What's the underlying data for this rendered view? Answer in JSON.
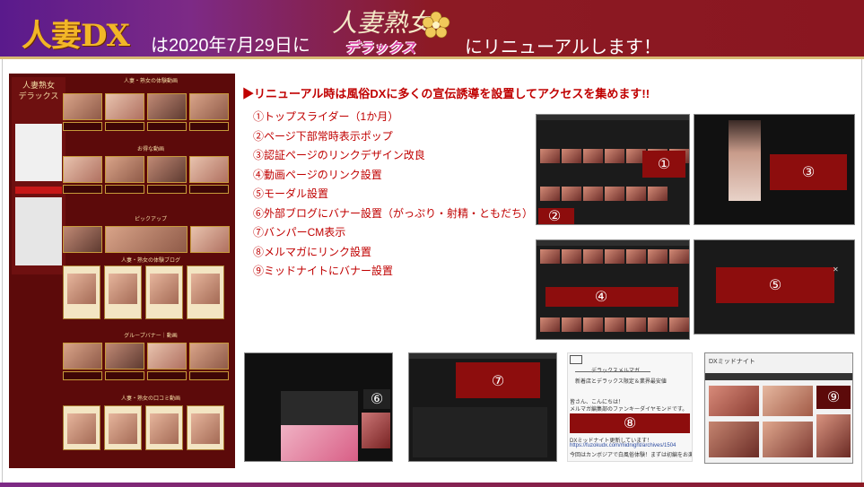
{
  "header": {
    "old_brand": "人妻DX",
    "announce_prefix": "は2020年7月29日に",
    "new_brand_top": "人妻熟女",
    "new_brand_bottom": "デラックス",
    "announce_suffix": "にリニューアルします！",
    "colors": {
      "purple": "#5a1a8c",
      "crimson": "#8c1a24",
      "gold": "#f2b627"
    }
  },
  "lead": "▶リニューアル時は風俗DXに多くの宣伝誘導を設置してアクセスを集めます!!",
  "measures": [
    "①トップスライダー（1か月）",
    "②ページ下部常時表示ポップ",
    "③認証ページのリンクデザイン改良",
    "④動画ページのリンク設置",
    "⑤モーダル設置",
    "⑥外部ブログにバナー設置（がっぷり・射精・ともだち）",
    "⑦バンパーCM表示",
    "⑧メルマガにリンク設置",
    "⑨ミッドナイトにバナー設置"
  ],
  "markers": [
    "①",
    "②",
    "③",
    "④",
    "⑤",
    "⑥",
    "⑦",
    "⑧",
    "⑨"
  ],
  "mockup": {
    "sections": [
      "人妻・熟女の体験動画",
      "お得な動画",
      "ピックアップ",
      "人妻・熟女の体験ブログ",
      "グループバナー｜動画",
      "人妻・熟女の口コミ動画"
    ]
  },
  "mailmag": {
    "title": "デラックスメルマガ",
    "sub": "新着店とデラックス限定＆業界最安値",
    "greet1": "皆さん、こんにちは！",
    "greet2": "メルマガ編集部のファンキーダイヤモンドです。",
    "notice": "DXミッドナイト更新しています！",
    "url": "https://fuzokudx.com/midnight/archives/1504",
    "tail": "今回はカンボジアで白風俗体験！まずは初編をお楽しみください☆"
  },
  "midnight": {
    "title": "DXミッドナイト"
  }
}
